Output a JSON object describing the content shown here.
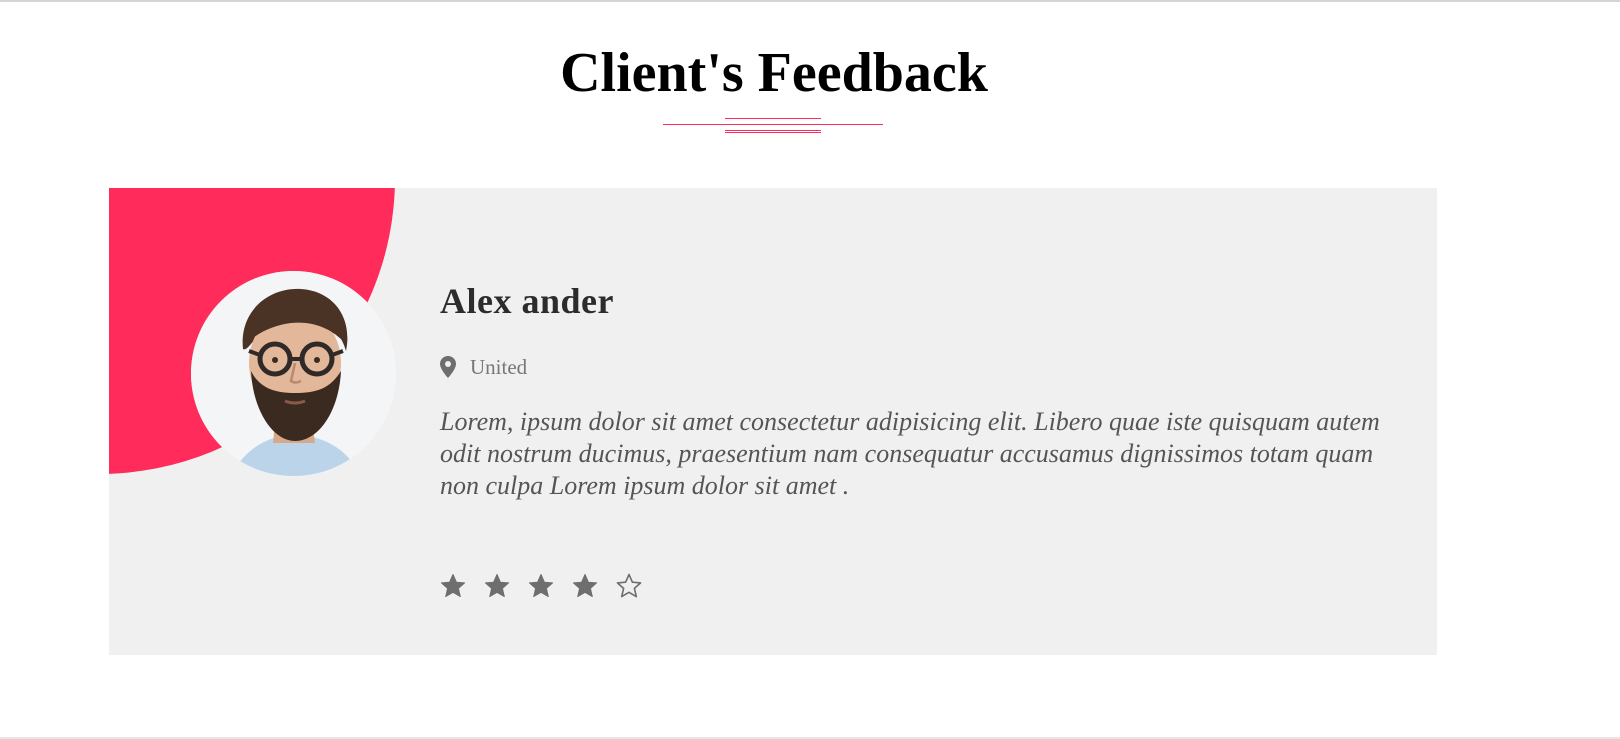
{
  "section": {
    "title": "Client's Feedback"
  },
  "testimonial": {
    "client_name": "Alex ander",
    "location": "United",
    "quote": "Lorem, ipsum dolor sit amet consectetur adipisicing elit. Libero quae iste quisquam autem odit nostrum ducimus, praesentium nam consequatur accusamus dignissimos totam quam non culpa Lorem ipsum dolor sit amet .",
    "rating": 4,
    "rating_max": 5
  },
  "icons": {
    "location": "map-pin-icon",
    "star_filled": "star-filled-icon",
    "star_empty": "star-outline-icon"
  },
  "colors": {
    "accent": "#ff2b5a",
    "card_background": "#f0f0f0",
    "star": "#6e6e6e",
    "title": "#000000"
  }
}
